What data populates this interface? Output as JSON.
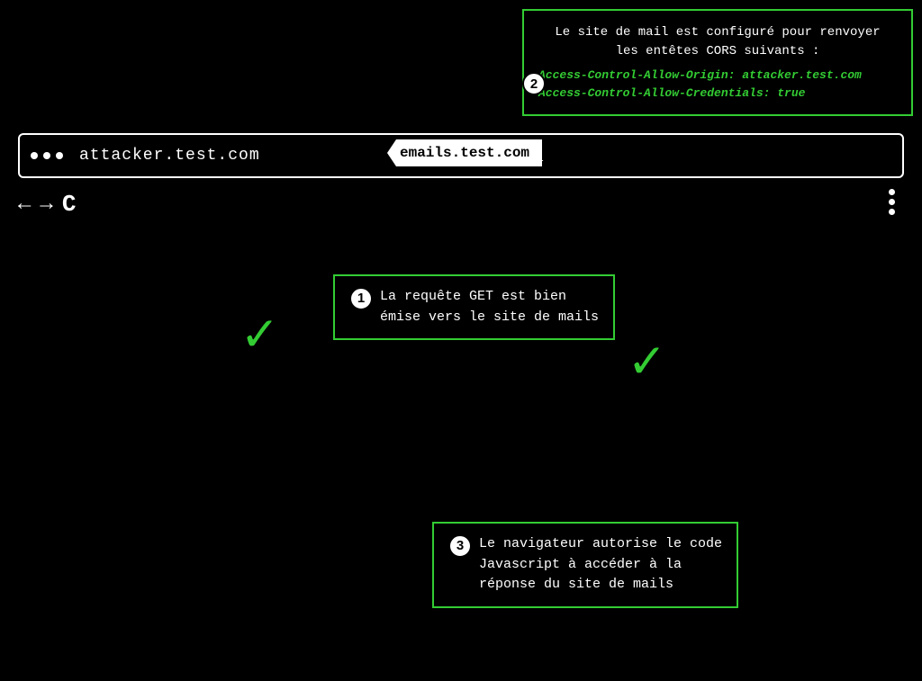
{
  "browser": {
    "url": "attacker.test.com",
    "dots": [
      "dot1",
      "dot2",
      "dot3"
    ]
  },
  "email_tag": {
    "label": "emails.test.com"
  },
  "cors_box": {
    "title": "Le site de mail est configuré pour renvoyer\nles entêtes CORS suivants :",
    "header1": "Access-Control-Allow-Origin: attacker.test.com",
    "header2": "Access-Control-Allow-Credentials: true",
    "bubble": "2"
  },
  "info_box_1": {
    "text": "La requête GET est bien\némise vers le site de mails",
    "bubble": "1"
  },
  "info_box_3": {
    "text": "Le navigateur autorise le code\nJavascript à accéder à la\nréponse du site de mails",
    "bubble": "3"
  },
  "checkmarks": {
    "left": "✓",
    "right": "✓"
  },
  "nav": {
    "back": "←",
    "forward": "→",
    "refresh": "C"
  }
}
